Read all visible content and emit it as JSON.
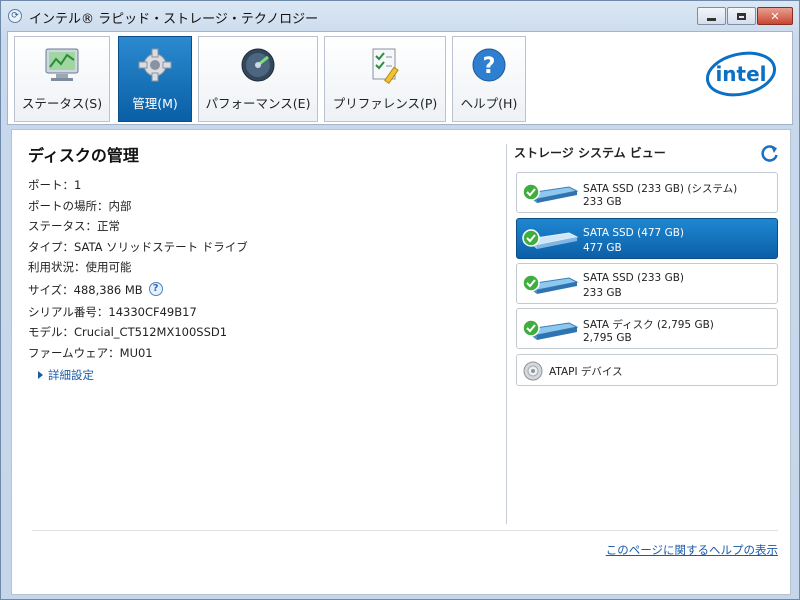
{
  "window": {
    "title": "インテル® ラピッド・ストレージ・テクノロジー",
    "minimize_label": "",
    "maximize_label": "",
    "close_label": "✕"
  },
  "toolbar": {
    "items": [
      {
        "label": "ステータス(S)",
        "icon": "status-monitor-icon"
      },
      {
        "label": "管理(M)",
        "icon": "gear-icon",
        "active": true
      },
      {
        "label": "パフォーマンス(E)",
        "icon": "speedometer-icon"
      },
      {
        "label": "プリファレンス(P)",
        "icon": "preferences-checklist-icon"
      },
      {
        "label": "ヘルプ(H)",
        "icon": "help-icon"
      }
    ],
    "logo_text": "intel",
    "accent_color": "#0a5fa6"
  },
  "disk": {
    "title": "ディスクの管理",
    "properties": [
      "ポート：1",
      "ポートの場所：内部",
      "ステータス：正常",
      "タイプ：SATA ソリッドステート ドライブ",
      "利用状況：使用可能",
      "サイズ：488,386 MB",
      "シリアル番号：14330CF49B17",
      "モデル：Crucial_CT512MX100SSD1",
      "ファームウェア：MU01"
    ],
    "size_help_icon": "?",
    "details_link": "詳細設定"
  },
  "storage_view": {
    "title": "ストレージ システム ビュー",
    "drives": [
      {
        "name": "SATA SSD (233 GB) (システム)",
        "size": "233 GB",
        "selected": false
      },
      {
        "name": "SATA SSD (477 GB)",
        "size": "477 GB",
        "selected": true
      },
      {
        "name": "SATA SSD (233 GB)",
        "size": "233 GB",
        "selected": false
      },
      {
        "name": "SATA ディスク (2,795 GB)",
        "size": "2,795 GB",
        "selected": false
      }
    ],
    "atapi": {
      "name": "ATAPI デバイス"
    }
  },
  "footer": {
    "help_link": "このページに関するヘルプの表示"
  }
}
